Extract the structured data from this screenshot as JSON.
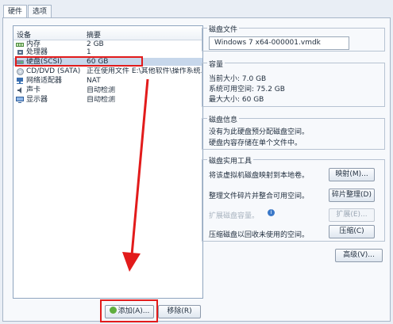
{
  "tabs": [
    "硬件",
    "选项"
  ],
  "device_list": {
    "header": {
      "device": "设备",
      "summary": "摘要"
    },
    "rows": [
      {
        "icon": "memory-icon",
        "name": "内存",
        "summary": "2 GB"
      },
      {
        "icon": "cpu-icon",
        "name": "处理器",
        "summary": "1"
      },
      {
        "icon": "harddisk-icon",
        "name": "硬盘(SCSI)",
        "summary": "60 GB"
      },
      {
        "icon": "cd-dvd-icon",
        "name": "CD/DVD (SATA)",
        "summary": "正在使用文件 E:\\其他软件\\操作系统..."
      },
      {
        "icon": "network-icon",
        "name": "网络适配器",
        "summary": "NAT"
      },
      {
        "icon": "sound-icon",
        "name": "声卡",
        "summary": "自动检测"
      },
      {
        "icon": "display-icon",
        "name": "显示器",
        "summary": "自动检测"
      }
    ]
  },
  "buttons": {
    "add": "添加(A)...",
    "remove": "移除(R)"
  },
  "disk_file": {
    "title": "磁盘文件",
    "value": "Windows 7 x64-000001.vmdk"
  },
  "capacity": {
    "title": "容量",
    "current": "当前大小: 7.0 GB",
    "available": "系统可用空间: 75.2 GB",
    "max": "最大大小: 60 GB"
  },
  "disk_info": {
    "title": "磁盘信息",
    "line1": "没有为此硬盘预分配磁盘空间。",
    "line2": "硬盘内容存储在单个文件中。"
  },
  "utilities": {
    "title": "磁盘实用工具",
    "map_text": "将该虚拟机磁盘映射到本地卷。",
    "map_btn": "映射(M)...",
    "defrag_text": "整理文件碎片并整合可用空间。",
    "defrag_btn": "碎片整理(D)",
    "expand_text": "扩展磁盘容量。",
    "expand_btn": "扩展(E)...",
    "compact_text": "压缩磁盘以回收未使用的空间。",
    "compact_btn": "压缩(C)"
  },
  "advanced_btn": "高级(V)...",
  "colors": {
    "accent": "#e21b1b",
    "selection": "#c7d7eb"
  }
}
